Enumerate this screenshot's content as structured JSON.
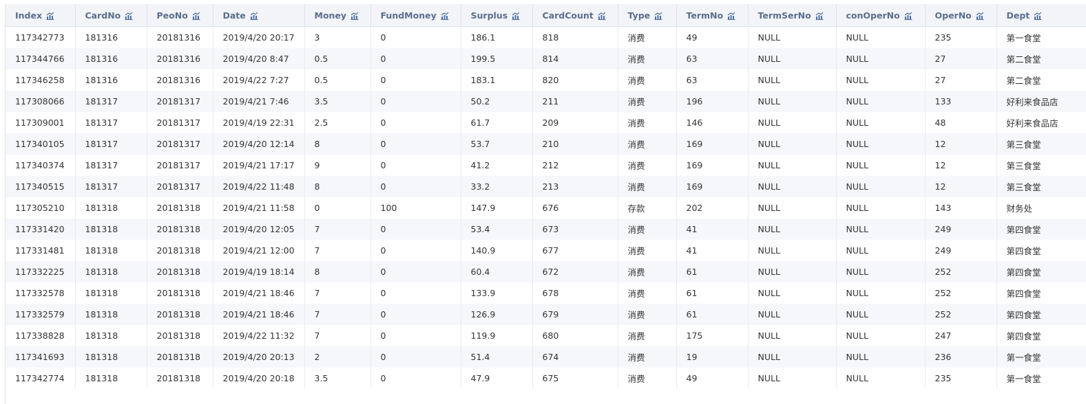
{
  "columns": [
    {
      "key": "index",
      "label": "Index"
    },
    {
      "key": "card_no",
      "label": "CardNo"
    },
    {
      "key": "peo_no",
      "label": "PeoNo"
    },
    {
      "key": "date",
      "label": "Date"
    },
    {
      "key": "money",
      "label": "Money"
    },
    {
      "key": "fund_money",
      "label": "FundMoney"
    },
    {
      "key": "surplus",
      "label": "Surplus"
    },
    {
      "key": "card_count",
      "label": "CardCount"
    },
    {
      "key": "type",
      "label": "Type"
    },
    {
      "key": "term_no",
      "label": "TermNo"
    },
    {
      "key": "term_ser_no",
      "label": "TermSerNo"
    },
    {
      "key": "con_oper_no",
      "label": "conOperNo"
    },
    {
      "key": "oper_no",
      "label": "OperNo"
    },
    {
      "key": "dept",
      "label": "Dept"
    }
  ],
  "header_icon": "column-chart-icon",
  "colors": {
    "header_bg": "#f2f4f8",
    "header_text": "#5a6e8c",
    "icon": "#4a6fa5",
    "stripe": "#f5f7fa",
    "border": "#dfe3ea"
  },
  "rows": [
    [
      "117342773",
      "181316",
      "20181316",
      "2019/4/20 20:17",
      "3",
      "0",
      "186.1",
      "818",
      "消费",
      "49",
      "NULL",
      "NULL",
      "235",
      "第一食堂"
    ],
    [
      "117344766",
      "181316",
      "20181316",
      "2019/4/20 8:47",
      "0.5",
      "0",
      "199.5",
      "814",
      "消费",
      "63",
      "NULL",
      "NULL",
      "27",
      "第二食堂"
    ],
    [
      "117346258",
      "181316",
      "20181316",
      "2019/4/22 7:27",
      "0.5",
      "0",
      "183.1",
      "820",
      "消费",
      "63",
      "NULL",
      "NULL",
      "27",
      "第二食堂"
    ],
    [
      "117308066",
      "181317",
      "20181317",
      "2019/4/21 7:46",
      "3.5",
      "0",
      "50.2",
      "211",
      "消费",
      "196",
      "NULL",
      "NULL",
      "133",
      "好利来食品店"
    ],
    [
      "117309001",
      "181317",
      "20181317",
      "2019/4/19 22:31",
      "2.5",
      "0",
      "61.7",
      "209",
      "消费",
      "146",
      "NULL",
      "NULL",
      "48",
      "好利来食品店"
    ],
    [
      "117340105",
      "181317",
      "20181317",
      "2019/4/20 12:14",
      "8",
      "0",
      "53.7",
      "210",
      "消费",
      "169",
      "NULL",
      "NULL",
      "12",
      "第三食堂"
    ],
    [
      "117340374",
      "181317",
      "20181317",
      "2019/4/21 17:17",
      "9",
      "0",
      "41.2",
      "212",
      "消费",
      "169",
      "NULL",
      "NULL",
      "12",
      "第三食堂"
    ],
    [
      "117340515",
      "181317",
      "20181317",
      "2019/4/22 11:48",
      "8",
      "0",
      "33.2",
      "213",
      "消费",
      "169",
      "NULL",
      "NULL",
      "12",
      "第三食堂"
    ],
    [
      "117305210",
      "181318",
      "20181318",
      "2019/4/21 11:58",
      "0",
      "100",
      "147.9",
      "676",
      "存款",
      "202",
      "NULL",
      "NULL",
      "143",
      "财务处"
    ],
    [
      "117331420",
      "181318",
      "20181318",
      "2019/4/20 12:05",
      "7",
      "0",
      "53.4",
      "673",
      "消费",
      "41",
      "NULL",
      "NULL",
      "249",
      "第四食堂"
    ],
    [
      "117331481",
      "181318",
      "20181318",
      "2019/4/21 12:00",
      "7",
      "0",
      "140.9",
      "677",
      "消费",
      "41",
      "NULL",
      "NULL",
      "249",
      "第四食堂"
    ],
    [
      "117332225",
      "181318",
      "20181318",
      "2019/4/19 18:14",
      "8",
      "0",
      "60.4",
      "672",
      "消费",
      "61",
      "NULL",
      "NULL",
      "252",
      "第四食堂"
    ],
    [
      "117332578",
      "181318",
      "20181318",
      "2019/4/21 18:46",
      "7",
      "0",
      "133.9",
      "678",
      "消费",
      "61",
      "NULL",
      "NULL",
      "252",
      "第四食堂"
    ],
    [
      "117332579",
      "181318",
      "20181318",
      "2019/4/21 18:46",
      "7",
      "0",
      "126.9",
      "679",
      "消费",
      "61",
      "NULL",
      "NULL",
      "252",
      "第四食堂"
    ],
    [
      "117338828",
      "181318",
      "20181318",
      "2019/4/22 11:32",
      "7",
      "0",
      "119.9",
      "680",
      "消费",
      "175",
      "NULL",
      "NULL",
      "247",
      "第四食堂"
    ],
    [
      "117341693",
      "181318",
      "20181318",
      "2019/4/20 20:13",
      "2",
      "0",
      "51.4",
      "674",
      "消费",
      "19",
      "NULL",
      "NULL",
      "236",
      "第一食堂"
    ],
    [
      "117342774",
      "181318",
      "20181318",
      "2019/4/20 20:18",
      "3.5",
      "0",
      "47.9",
      "675",
      "消费",
      "49",
      "NULL",
      "NULL",
      "235",
      "第一食堂"
    ]
  ]
}
